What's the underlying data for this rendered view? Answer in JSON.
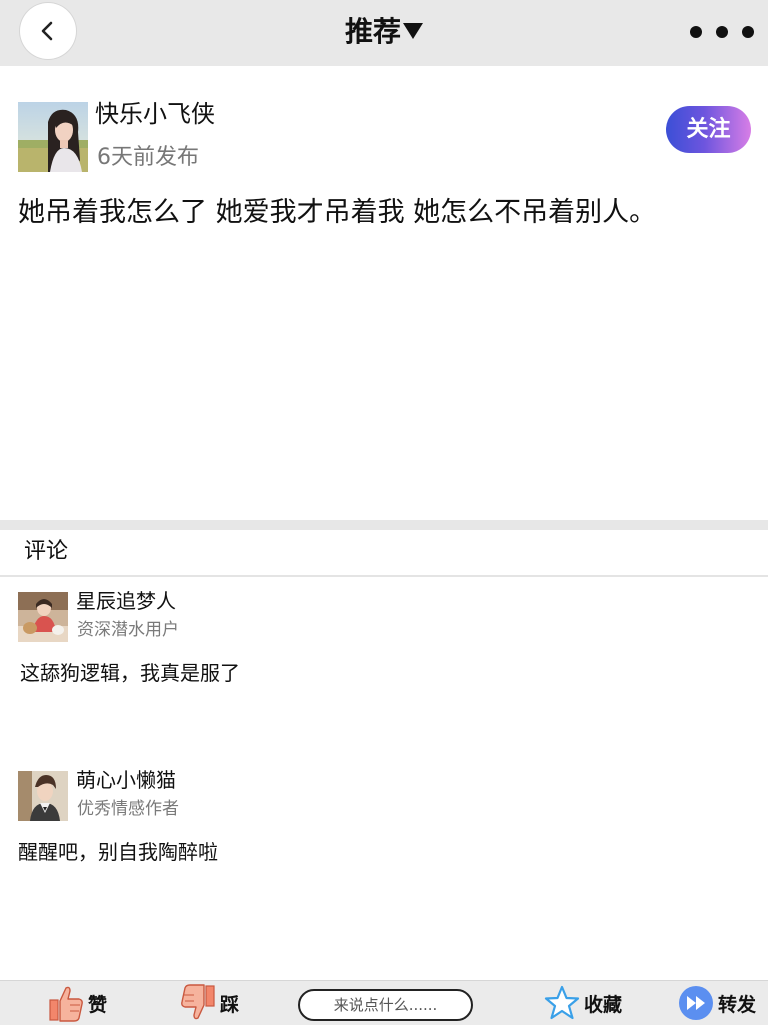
{
  "header": {
    "title": "推荐",
    "back_icon": "chevron-left-icon",
    "more_icon": "more-dots-icon"
  },
  "post": {
    "author": "快乐小飞侠",
    "time": "6天前发布",
    "follow_label": "关注",
    "text": "她吊着我怎么了 她爱我才吊着我 她怎么不吊着别人。",
    "colors": {
      "follow_gradient_start": "#3b4fd6",
      "follow_gradient_end": "#d77ee6"
    }
  },
  "comments_section": {
    "heading": "评论",
    "items": [
      {
        "name": "星辰追梦人",
        "badge": "资深潜水用户",
        "text": "这舔狗逻辑，我真是服了"
      },
      {
        "name": "萌心小懒猫",
        "badge": "优秀情感作者",
        "text": "醒醒吧，别自我陶醉啦"
      }
    ]
  },
  "bottom_bar": {
    "like_label": "赞",
    "dislike_label": "踩",
    "comment_placeholder": "来说点什么......",
    "favorite_label": "收藏",
    "share_label": "转发",
    "icons": {
      "like": "thumbs-up-icon",
      "dislike": "thumbs-down-icon",
      "favorite": "star-icon",
      "share": "fast-forward-icon"
    },
    "colors": {
      "thumb": "#f2866b",
      "star": "#3aa0e8",
      "share": "#5b8ff0"
    }
  }
}
